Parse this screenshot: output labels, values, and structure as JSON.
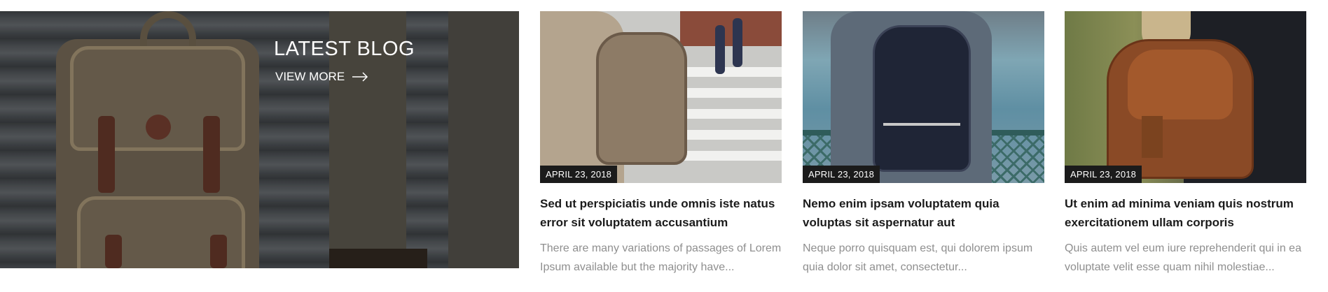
{
  "hero": {
    "title": "LATEST BLOG",
    "view_more_label": "VIEW MORE",
    "arrow_icon": "arrow-right-icon"
  },
  "posts": [
    {
      "date": "APRIL 23, 2018",
      "title": "Sed ut perspiciatis unde omnis iste natus error sit voluptatem accusantium",
      "excerpt": "There are many variations of passages of Lorem Ipsum available but the majority have..."
    },
    {
      "date": "APRIL 23, 2018",
      "title": "Nemo enim ipsam voluptatem quia voluptas sit aspernatur aut",
      "excerpt": "Neque porro quisquam est, qui dolorem ipsum quia dolor sit amet, consectetur..."
    },
    {
      "date": "APRIL 23, 2018",
      "title": "Ut enim ad minima veniam quis nostrum exercitationem ullam corporis",
      "excerpt": "Quis autem vel eum iure reprehenderit qui in ea voluptate velit esse quam nihil molestiae..."
    }
  ],
  "colors": {
    "title_text": "#1b1b1b",
    "excerpt_text": "#8f8f8f",
    "date_badge_bg": "#1b1b1b"
  }
}
